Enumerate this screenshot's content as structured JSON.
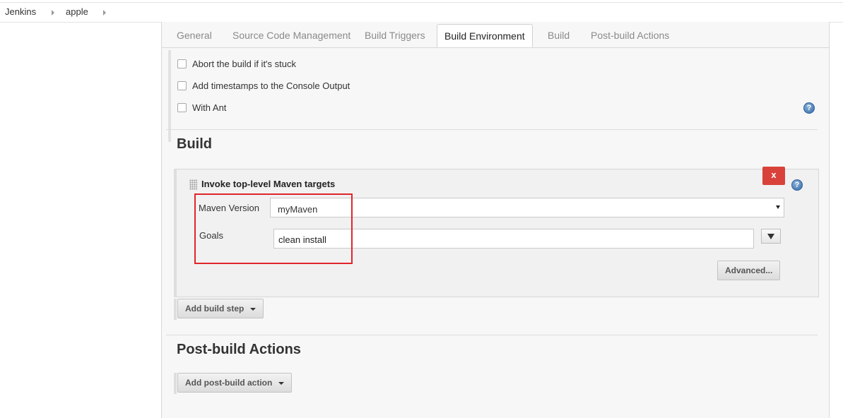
{
  "breadcrumb": {
    "items": [
      "Jenkins",
      "apple"
    ]
  },
  "tabs": [
    "General",
    "Source Code Management",
    "Build Triggers",
    "Build Environment",
    "Build",
    "Post-build Actions"
  ],
  "active_tab": "Build Environment",
  "build_environment": {
    "options": [
      {
        "label": "Abort the build if it's stuck",
        "checked": false
      },
      {
        "label": "Add timestamps to the Console Output",
        "checked": false
      },
      {
        "label": "With Ant",
        "checked": false
      }
    ]
  },
  "build": {
    "title": "Build",
    "step": {
      "title": "Invoke top-level Maven targets",
      "delete_label": "x",
      "maven_version_label": "Maven Version",
      "maven_version_value": "myMaven",
      "goals_label": "Goals",
      "goals_value": "clean install",
      "advanced_label": "Advanced..."
    },
    "add_step_label": "Add build step"
  },
  "post_build": {
    "title": "Post-build Actions",
    "add_action_label": "Add post-build action"
  },
  "help_icon_text": "?",
  "colors": {
    "highlight": "#e0252b",
    "delete_button": "#d9423a",
    "help_icon": "#2f6aa8"
  }
}
